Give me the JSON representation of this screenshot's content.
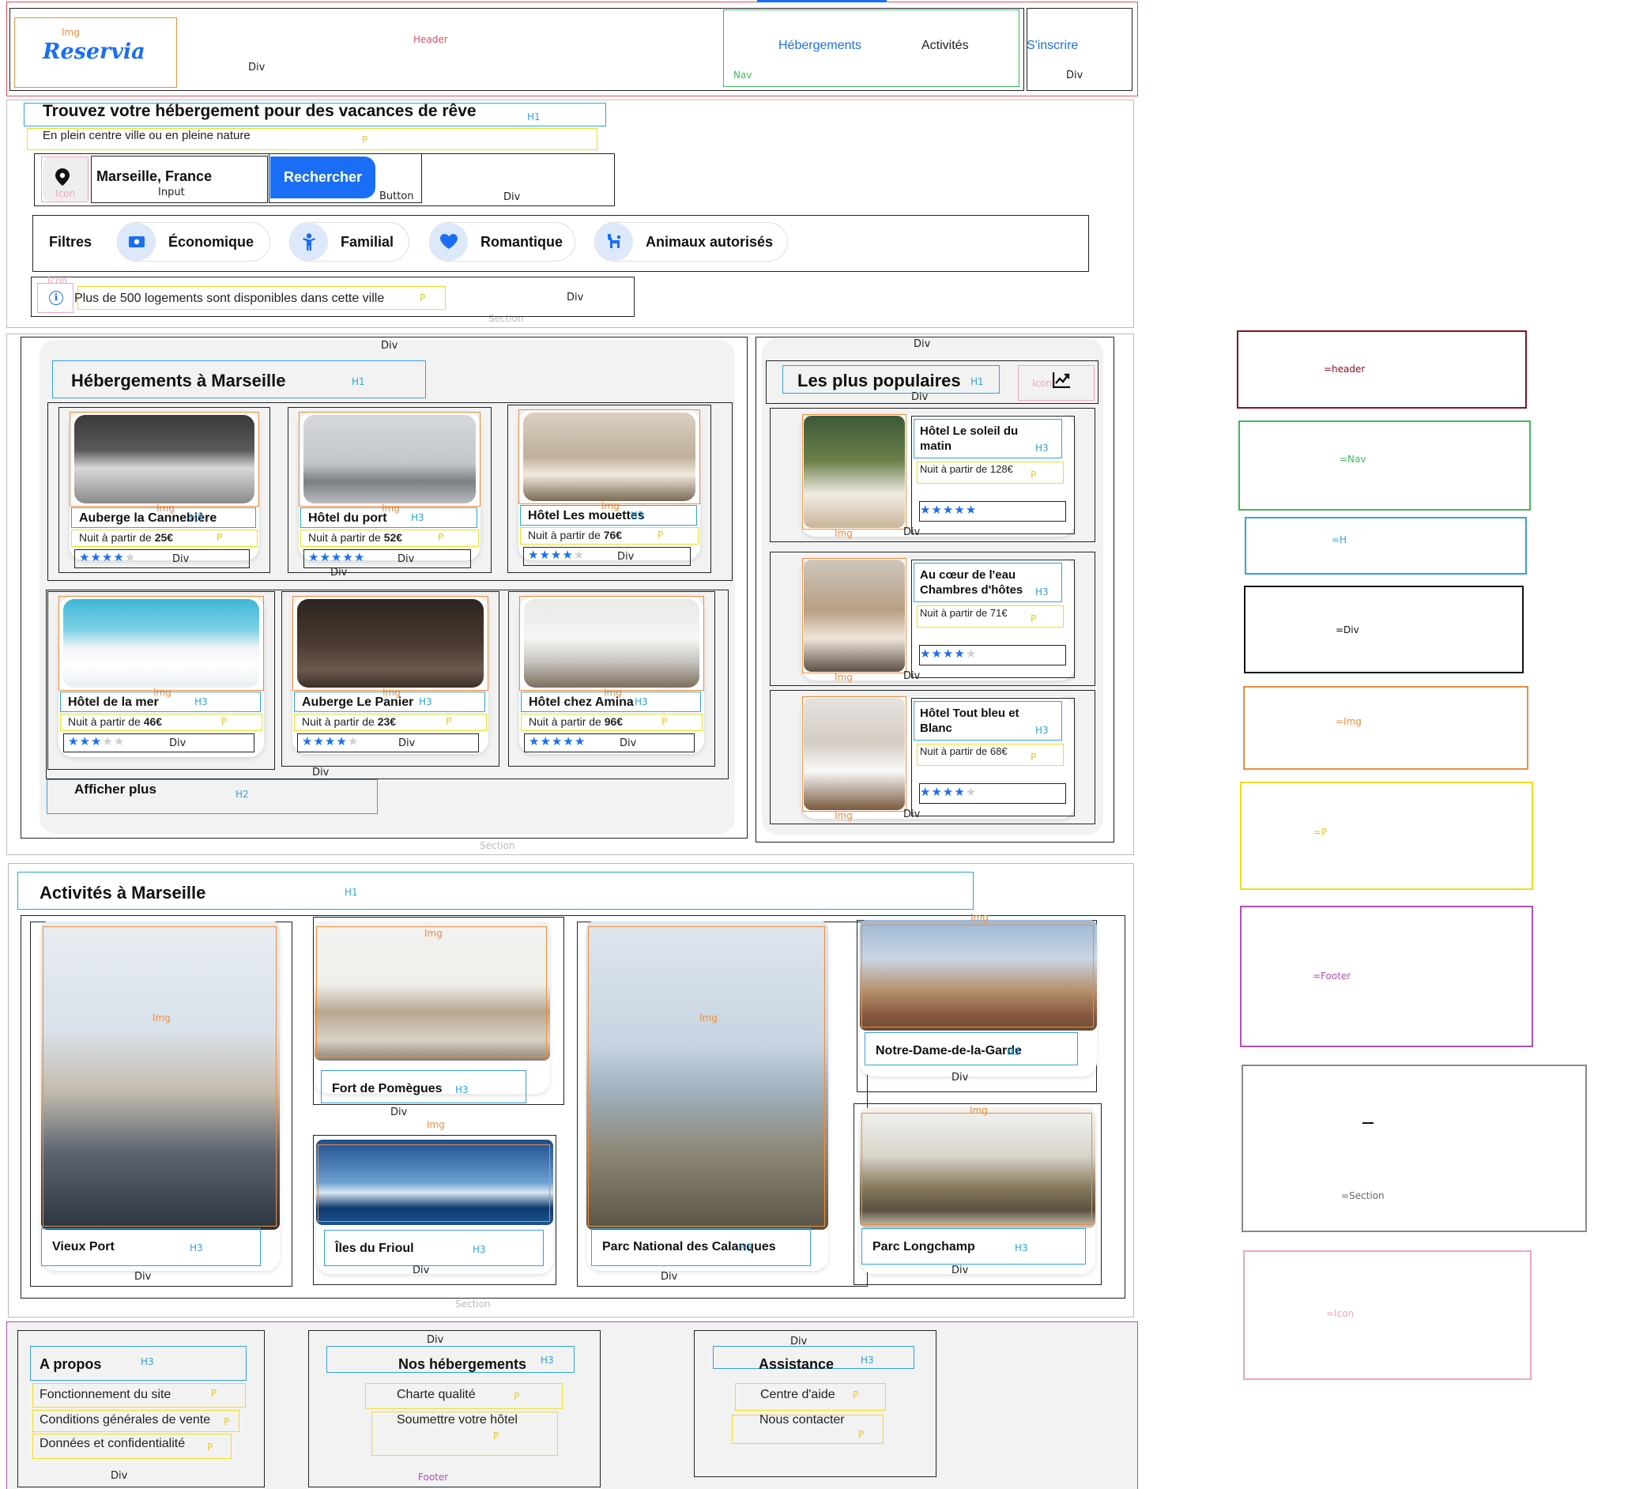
{
  "header": {
    "logo": "Reservia",
    "nav": [
      "Hébergements",
      "Activités"
    ],
    "signup": "S'inscrire"
  },
  "hero": {
    "title": "Trouvez votre hébergement pour des vacances de rêve",
    "subtitle": "En plein centre ville ou en pleine nature",
    "search_value": "Marseille, France",
    "search_button": "Rechercher",
    "filters_label": "Filtres",
    "filters": [
      "Économique",
      "Familial",
      "Romantique",
      "Animaux autorisés"
    ],
    "info": "Plus de 500 logements sont disponibles dans cette ville"
  },
  "lodging": {
    "title": "Hébergements à Marseille",
    "price_prefix": "Nuit à partir de ",
    "more": "Afficher plus",
    "items": [
      {
        "name": "Auberge la Cannebière",
        "price": "25€",
        "rating": 4
      },
      {
        "name": "Hôtel du port",
        "price": "52€",
        "rating": 5
      },
      {
        "name": "Hôtel Les mouettes",
        "price": "76€",
        "rating": 4
      },
      {
        "name": "Hôtel de la mer",
        "price": "46€",
        "rating": 3
      },
      {
        "name": "Auberge Le Panier",
        "price": "23€",
        "rating": 4
      },
      {
        "name": "Hôtel chez Amina",
        "price": "96€",
        "rating": 5
      }
    ]
  },
  "popular": {
    "title": "Les plus populaires",
    "items": [
      {
        "name": "Hôtel Le soleil du matin",
        "price": "Nuit à partir de 128€",
        "rating": 5
      },
      {
        "name": "Au cœur de l'eau Chambres d'hôtes",
        "price": "Nuit à partir de 71€",
        "rating": 4
      },
      {
        "name": "Hôtel Tout bleu et Blanc",
        "price": "Nuit à partir de 68€",
        "rating": 4
      }
    ]
  },
  "activities": {
    "title": "Activités à Marseille",
    "items": [
      "Vieux Port",
      "Fort de Pomègues",
      "Îles du Frioul",
      "Parc National des Calanques",
      "Notre-Dame-de-la-Garde",
      "Parc Longchamp"
    ]
  },
  "footer": {
    "col1": {
      "title": "A propos",
      "links": [
        "Fonctionnement du site",
        "Conditions générales de vente",
        "Données et confidentialité"
      ]
    },
    "col2": {
      "title": "Nos hébergements",
      "links": [
        "Charte qualité",
        "Soumettre votre hôtel"
      ]
    },
    "col3": {
      "title": "Assistance",
      "links": [
        "Centre d'aide",
        "Nous contacter"
      ]
    }
  },
  "legend": [
    "=header",
    "=Nav",
    "=H",
    "=Div",
    "=Img",
    "=P",
    "=Footer",
    "=Section",
    "=Icon"
  ],
  "annotations": {
    "img": "Img",
    "header": "Header",
    "div": "Div",
    "nav": "Nav",
    "h1": "H1",
    "h2": "H2",
    "h3": "H3",
    "p": "P",
    "icon": "Icon",
    "input": "Input",
    "button": "Button",
    "section": "Section",
    "footer": "Footer"
  },
  "colors": {
    "accent": "#1a6ef5",
    "panel": "#f2f2f2"
  }
}
